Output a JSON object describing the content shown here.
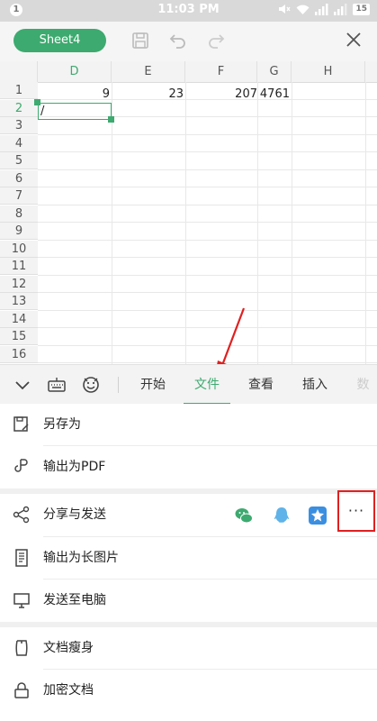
{
  "status_bar": {
    "notification_count": "1",
    "time": "11:03 PM",
    "battery": "15"
  },
  "toolbar": {
    "sheet_name": "Sheet4"
  },
  "grid": {
    "columns": [
      "D",
      "E",
      "F",
      "G",
      "H"
    ],
    "active_column": "D",
    "rows": [
      "1",
      "2",
      "3",
      "4",
      "5",
      "6",
      "7",
      "8",
      "9",
      "10",
      "11",
      "12",
      "13",
      "14",
      "15",
      "16"
    ],
    "active_row": "2",
    "row1_values": {
      "D": "9",
      "E": "23",
      "F": "207",
      "G": "4761"
    },
    "active_cell_input": "/"
  },
  "tabs": {
    "items": [
      {
        "label": "开始"
      },
      {
        "label": "文件"
      },
      {
        "label": "查看"
      },
      {
        "label": "插入"
      },
      {
        "label": "数"
      }
    ],
    "active": "文件"
  },
  "menu": {
    "save_as": "另存为",
    "export_pdf": "输出为PDF",
    "share_send": "分享与发送",
    "export_long_image": "输出为长图片",
    "send_to_pc": "发送至电脑",
    "slim_document": "文档瘦身",
    "encrypt_document": "加密文档",
    "more": "···"
  },
  "colors": {
    "accent": "#3daa6f",
    "highlight_red": "#e02020"
  },
  "share_apps": [
    "wechat-icon",
    "qq-icon",
    "qq-zone-icon"
  ]
}
